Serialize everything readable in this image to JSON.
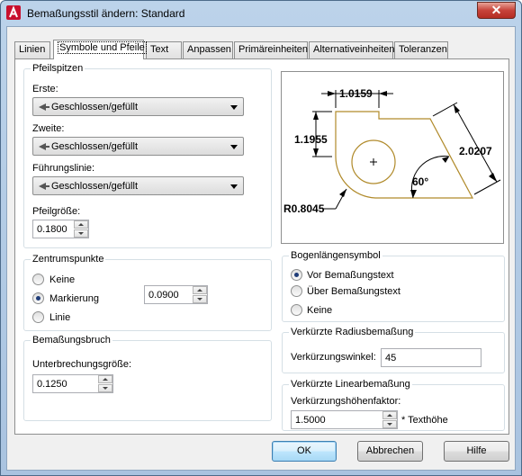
{
  "window": {
    "title": "Bemaßungsstil ändern: Standard",
    "close_label": "✕"
  },
  "tabs": [
    {
      "label": "Linien"
    },
    {
      "label": "Symbole und Pfeile"
    },
    {
      "label": "Text"
    },
    {
      "label": "Anpassen"
    },
    {
      "label": "Primäreinheiten"
    },
    {
      "label": "Alternativeinheiten"
    },
    {
      "label": "Toleranzen"
    }
  ],
  "pfeilspitzen": {
    "title": "Pfeilspitzen",
    "erste_label": "Erste:",
    "erste_value": "Geschlossen/gefüllt",
    "zweite_label": "Zweite:",
    "zweite_value": "Geschlossen/gefüllt",
    "fuehrung_label": "Führungslinie:",
    "fuehrung_value": "Geschlossen/gefüllt",
    "groesse_label": "Pfeilgröße:",
    "groesse_value": "0.1800"
  },
  "zentrum": {
    "title": "Zentrumspunkte",
    "keine": "Keine",
    "markierung": "Markierung",
    "linie": "Linie",
    "value": "0.0900"
  },
  "bruch": {
    "title": "Bemaßungsbruch",
    "label": "Unterbrechungsgröße:",
    "value": "0.1250"
  },
  "preview": {
    "dim_top": "1.0159",
    "dim_left": "1.1955",
    "dim_right": "2.0207",
    "angle": "60°",
    "radius": "R0.8045"
  },
  "bogen": {
    "title": "Bogenlängensymbol",
    "vor": "Vor Bemaßungstext",
    "ueber": "Über Bemaßungstext",
    "keine": "Keine"
  },
  "radius": {
    "title": "Verkürzte Radiusbemaßung",
    "label": "Verkürzungswinkel:",
    "value": "45"
  },
  "linear": {
    "title": "Verkürzte Linearbemaßung",
    "label": "Verkürzungshöhenfaktor:",
    "value": "1.5000",
    "suffix": "* Texthöhe"
  },
  "buttons": {
    "ok": "OK",
    "cancel": "Abbrechen",
    "help": "Hilfe"
  }
}
